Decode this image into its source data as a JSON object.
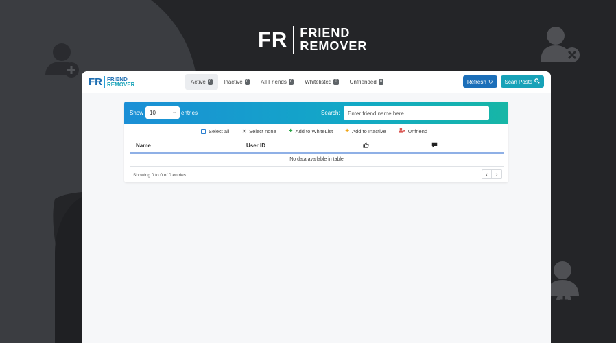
{
  "logo": {
    "initials": "FR",
    "line1": "FRIEND",
    "line2": "REMOVER"
  },
  "brand": {
    "initials": "FR",
    "line1": "FRIEND",
    "line2": "REMOVER"
  },
  "tabs": [
    {
      "label": "Active",
      "count": "0"
    },
    {
      "label": "Inactive",
      "count": "0"
    },
    {
      "label": "All Friends",
      "count": "0"
    },
    {
      "label": "Whitelisted",
      "count": "0"
    },
    {
      "label": "Unfriended",
      "count": "0"
    }
  ],
  "toolbar": {
    "refresh_label": "Refresh",
    "scan_label": "Scan Posts"
  },
  "table_controls": {
    "show_label": "Show",
    "show_value": "10",
    "entries_label": "entries",
    "search_label": "Search:",
    "search_placeholder": "Enter friend name here..."
  },
  "actions": {
    "select_all": "Select all",
    "select_none": "Select none",
    "add_whitelist": "Add to WhiteList",
    "add_inactive": "Add to Inactive",
    "unfriend": "Unfriend"
  },
  "table": {
    "columns": [
      "Name",
      "User ID"
    ],
    "icon_columns": [
      "thumbs-up-icon",
      "comment-icon"
    ],
    "empty_message": "No data available in table"
  },
  "footer": {
    "showing": "Showing 0 to 0 of 0 entries",
    "prev": "‹",
    "next": "›"
  },
  "colors": {
    "background": "#242528",
    "primary": "#1c6fb9",
    "info": "#17a2b8"
  }
}
